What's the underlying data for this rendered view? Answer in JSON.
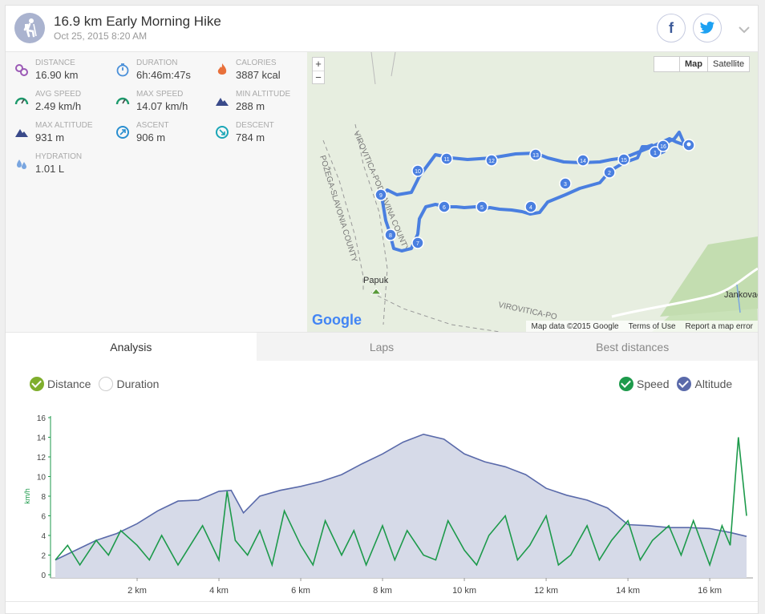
{
  "header": {
    "title": "16.9 km Early Morning Hike",
    "date": "Oct 25, 2015 8:20 AM",
    "facebook_glyph": "f"
  },
  "stats": [
    {
      "label": "DISTANCE",
      "value": "16.90 km",
      "icon": "distance-pin-icon",
      "color": "#9b59b6"
    },
    {
      "label": "DURATION",
      "value": "6h:46m:47s",
      "icon": "stopwatch-icon",
      "color": "#4a90d9"
    },
    {
      "label": "CALORIES",
      "value": "3887 kcal",
      "icon": "flame-icon",
      "color": "#e8703a"
    },
    {
      "label": "AVG SPEED",
      "value": "2.49 km/h",
      "icon": "speedometer-icon",
      "color": "#1d9a6c"
    },
    {
      "label": "MAX SPEED",
      "value": "14.07 km/h",
      "icon": "speedometer-icon",
      "color": "#1d9a6c"
    },
    {
      "label": "MIN ALTITUDE",
      "value": "288 m",
      "icon": "mountain-icon",
      "color": "#3a4a8a"
    },
    {
      "label": "MAX ALTITUDE",
      "value": "931 m",
      "icon": "mountain-icon",
      "color": "#3a4a8a"
    },
    {
      "label": "ASCENT",
      "value": "906 m",
      "icon": "ascent-icon",
      "color": "#2a8fd0"
    },
    {
      "label": "DESCENT",
      "value": "784 m",
      "icon": "descent-icon",
      "color": "#1aa6b7"
    },
    {
      "label": "HYDRATION",
      "value": "1.01 L",
      "icon": "water-drops-icon",
      "color": "#7aa6e0"
    }
  ],
  "map": {
    "zoom_in": "+",
    "zoom_out": "−",
    "type_map": "Map",
    "type_satellite": "Satellite",
    "labels": {
      "county1": "VIROVITICA-PODRAVINA COUNTY",
      "county2": "POŽEGA-SLAVONIA COUNTY",
      "county3": "VIROVITICA-PO",
      "peak": "Papuk",
      "village": "Jankovac"
    },
    "google_logo": "Google",
    "attribution": "Map data ©2015 Google",
    "terms": "Terms of Use",
    "report": "Report a map error",
    "route_color": "#4a7fe0",
    "markers": [
      "1",
      "2",
      "3",
      "4",
      "5",
      "6",
      "7",
      "8",
      "9",
      "10",
      "11",
      "12",
      "13",
      "14",
      "15",
      "16"
    ]
  },
  "tabs": [
    "Analysis",
    "Laps",
    "Best distances"
  ],
  "x_options": [
    {
      "label": "Distance",
      "checked": true,
      "color": "#7fae2d"
    },
    {
      "label": "Duration",
      "checked": false,
      "color": "#ffffff"
    }
  ],
  "y_options": [
    {
      "label": "Speed",
      "checked": true,
      "color": "#1d9a4b"
    },
    {
      "label": "Altitude",
      "checked": true,
      "color": "#5a6aaa"
    }
  ],
  "chart_data": {
    "type": "line",
    "ylabel": "km/h",
    "ylim": [
      0,
      16
    ],
    "yticks": [
      0,
      2,
      4,
      6,
      8,
      10,
      12,
      14,
      16
    ],
    "xlim": [
      0,
      16.9
    ],
    "xticks": [
      "2 km",
      "4 km",
      "6 km",
      "8 km",
      "10 km",
      "12 km",
      "14 km",
      "16 km"
    ],
    "xtick_values": [
      2,
      4,
      6,
      8,
      10,
      12,
      14,
      16
    ],
    "series": [
      {
        "name": "Altitude",
        "color": "#5a6aaa",
        "fill": "#d6dae8",
        "x": [
          0,
          0.5,
          1,
          1.5,
          2,
          2.5,
          3,
          3.5,
          4,
          4.3,
          4.6,
          5,
          5.5,
          6,
          6.5,
          7,
          7.5,
          8,
          8.5,
          9,
          9.5,
          10,
          10.5,
          11,
          11.5,
          12,
          12.5,
          13,
          13.5,
          14,
          14.5,
          15,
          15.5,
          16,
          16.5,
          16.9
        ],
        "values": [
          1.5,
          2.5,
          3.5,
          4.2,
          5.2,
          6.5,
          7.5,
          7.6,
          8.5,
          8.6,
          6.3,
          8.0,
          8.6,
          9.0,
          9.5,
          10.2,
          11.3,
          12.3,
          13.5,
          14.3,
          13.8,
          12.3,
          11.5,
          11.0,
          10.2,
          8.8,
          8.1,
          7.6,
          6.8,
          5.1,
          5.0,
          4.8,
          4.8,
          4.7,
          4.3,
          3.9
        ]
      },
      {
        "name": "Speed",
        "color": "#1d9a4b",
        "x": [
          0,
          0.3,
          0.6,
          1,
          1.3,
          1.6,
          2,
          2.3,
          2.6,
          3,
          3.3,
          3.6,
          4,
          4.2,
          4.4,
          4.7,
          5,
          5.3,
          5.6,
          6,
          6.3,
          6.6,
          7,
          7.3,
          7.6,
          8,
          8.3,
          8.6,
          9,
          9.3,
          9.6,
          10,
          10.3,
          10.6,
          11,
          11.3,
          11.6,
          12,
          12.3,
          12.6,
          13,
          13.3,
          13.6,
          14,
          14.3,
          14.6,
          15,
          15.3,
          15.6,
          16,
          16.3,
          16.5,
          16.7,
          16.9
        ],
        "values": [
          1.5,
          3.0,
          1.0,
          3.5,
          2.0,
          4.5,
          3.0,
          1.5,
          4.0,
          1.0,
          3.0,
          5.0,
          1.5,
          8.5,
          3.5,
          2.0,
          4.5,
          1.0,
          6.5,
          3.0,
          1.0,
          5.5,
          2.0,
          4.5,
          1.0,
          5.0,
          1.5,
          4.5,
          2.0,
          1.5,
          5.5,
          2.5,
          1.0,
          4.0,
          6.0,
          1.5,
          3.0,
          6.0,
          1.0,
          2.0,
          5.0,
          1.5,
          3.5,
          5.5,
          1.5,
          3.5,
          5.0,
          2.0,
          5.5,
          1.0,
          5.0,
          3.0,
          14.0,
          6.0
        ]
      }
    ]
  }
}
